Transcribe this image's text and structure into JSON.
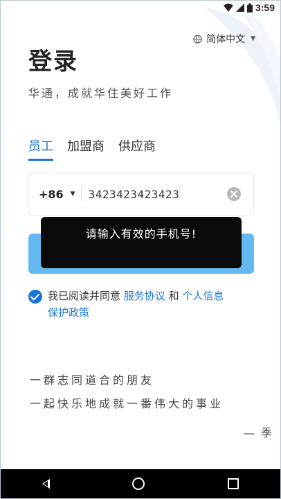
{
  "status_bar": {
    "time": "3:59"
  },
  "language": {
    "label": "简体中文"
  },
  "header": {
    "title": "登录",
    "subtitle": "华通，成就华住美好工作"
  },
  "tabs": [
    {
      "label": "员工",
      "active": true
    },
    {
      "label": "加盟商",
      "active": false
    },
    {
      "label": "供应商",
      "active": false
    }
  ],
  "phone": {
    "country_code": "+86",
    "value": "3423423423423"
  },
  "toast": {
    "message": "请输入有效的手机号!"
  },
  "agreement": {
    "prefix": "我已阅读并同意",
    "link1": "服务协议",
    "conjunction": "和",
    "link2_part1": "个人信息",
    "link2_part2": "保护政策"
  },
  "quote": {
    "line1": "一群志同道合的朋友",
    "line2": "一起快乐地成就一番伟大的事业",
    "attribution": "— 季"
  },
  "colors": {
    "accent": "#1976d2",
    "button": "#63b8ef",
    "toast_bg": "#0a0a0a"
  }
}
